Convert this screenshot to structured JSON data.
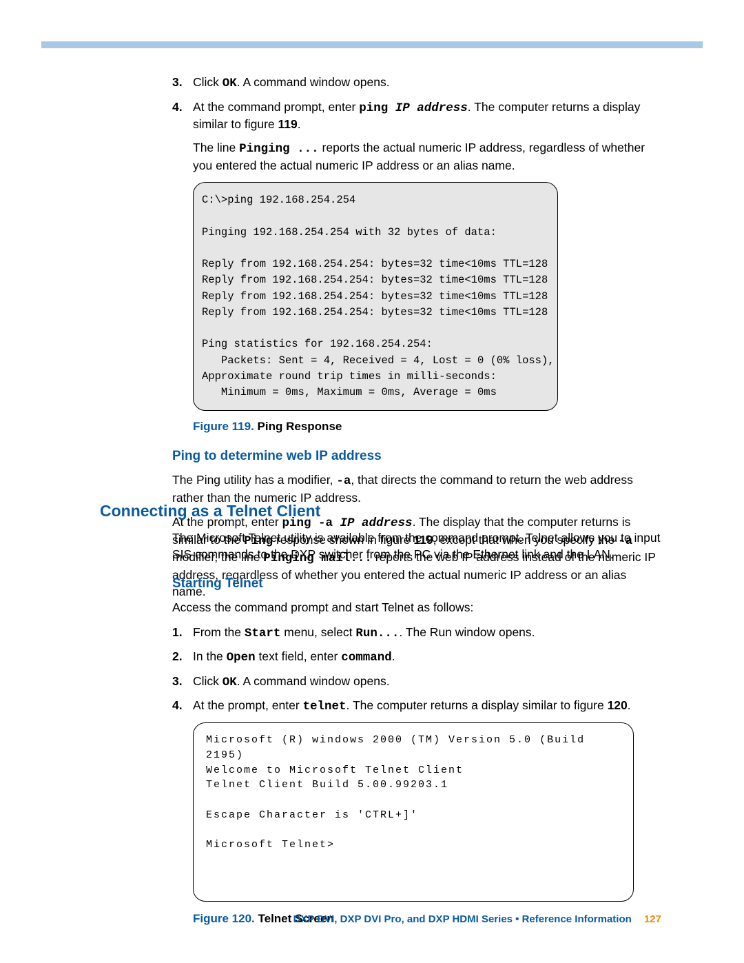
{
  "steps_a": {
    "s3": {
      "num": "3.",
      "pre": "Click ",
      "ok": "OK",
      "post": ". A command window opens."
    },
    "s4": {
      "num": "4.",
      "pre": "At the command prompt, enter ",
      "cmd1": "ping ",
      "cmd2": "IP address",
      "mid": ". The computer returns a display similar to figure ",
      "fignum": "119",
      "end": "."
    },
    "note_pre": "The line ",
    "note_code": "Pinging ...",
    "note_post": " reports the actual numeric IP address, regardless of whether you entered the actual numeric IP address or an alias name."
  },
  "ping_output": "C:\\>ping 192.168.254.254\n\nPinging 192.168.254.254 with 32 bytes of data:\n\nReply from 192.168.254.254: bytes=32 time<10ms TTL=128\nReply from 192.168.254.254: bytes=32 time<10ms TTL=128\nReply from 192.168.254.254: bytes=32 time<10ms TTL=128\nReply from 192.168.254.254: bytes=32 time<10ms TTL=128\n\nPing statistics for 192.168.254.254:\n   Packets: Sent = 4, Received = 4, Lost = 0 (0% loss),\nApproximate round trip times in milli-seconds:\n   Minimum = 0ms, Maximum = 0ms, Average = 0ms",
  "fig119": {
    "label": "Figure 119.",
    "title": "  Ping Response"
  },
  "sec_ping_web": {
    "heading": "Ping to determine web IP address",
    "p1_pre": "The Ping utility has a modifier, ",
    "p1_code": "-a",
    "p1_post": ", that directs the command to return the web address rather than the numeric IP address.",
    "p2_pre": "At the prompt, enter ",
    "p2_c1": "ping -a ",
    "p2_c2": "IP address",
    "p2_mid1": ". The display that the computer returns is similar to the ",
    "p2_c3": "Ping",
    "p2_mid2": " response shown in figure ",
    "p2_fig": "119",
    "p2_mid3": ", except that when you specify the ",
    "p2_c4": "-a",
    "p2_mid4": " modifier, the line ",
    "p2_c5": "Pinging mail...",
    "p2_post": " reports the web IP address instead of the numeric IP address, regardless of whether you entered the actual numeric IP address or an alias name."
  },
  "sec_telnet": {
    "heading": "Connecting as a Telnet Client",
    "intro": "The Microsoft Telnet utility is available from the command prompt. Telnet allows you to input SIS commands to the DXP switcher from the PC via the Ethernet link and the LAN.",
    "sub": "Starting Telnet",
    "lead": "Access the command prompt and start Telnet as follows:",
    "s1": {
      "num": "1.",
      "pre": "From the ",
      "c1": "Start",
      "mid": " menu, select ",
      "c2": "Run...",
      "post": ". The Run window opens."
    },
    "s2": {
      "num": "2.",
      "pre": "In the ",
      "c1": "Open",
      "mid": " text field, enter ",
      "c2": "command",
      "post": "."
    },
    "s3": {
      "num": "3.",
      "pre": "Click ",
      "c1": "OK",
      "post": ". A command window opens."
    },
    "s4": {
      "num": "4.",
      "pre": "At the prompt, enter ",
      "c1": "telnet",
      "mid": ". The computer returns a display similar to figure ",
      "fignum": "120",
      "post": "."
    }
  },
  "telnet_output": "Microsoft (R) windows 2000 (TM) Version 5.0 (Build 2195)\nWelcome to Microsoft Telnet Client\nTelnet Client Build 5.00.99203.1\n\nEscape Character is 'CTRL+]'\n\nMicrosoft Telnet>",
  "fig120": {
    "label": "Figure 120.",
    "title": "  Telnet Screen"
  },
  "footer": {
    "title": "DXP DVI, DXP DVI Pro, and DXP HDMI Series • Reference Information",
    "page": "127"
  }
}
